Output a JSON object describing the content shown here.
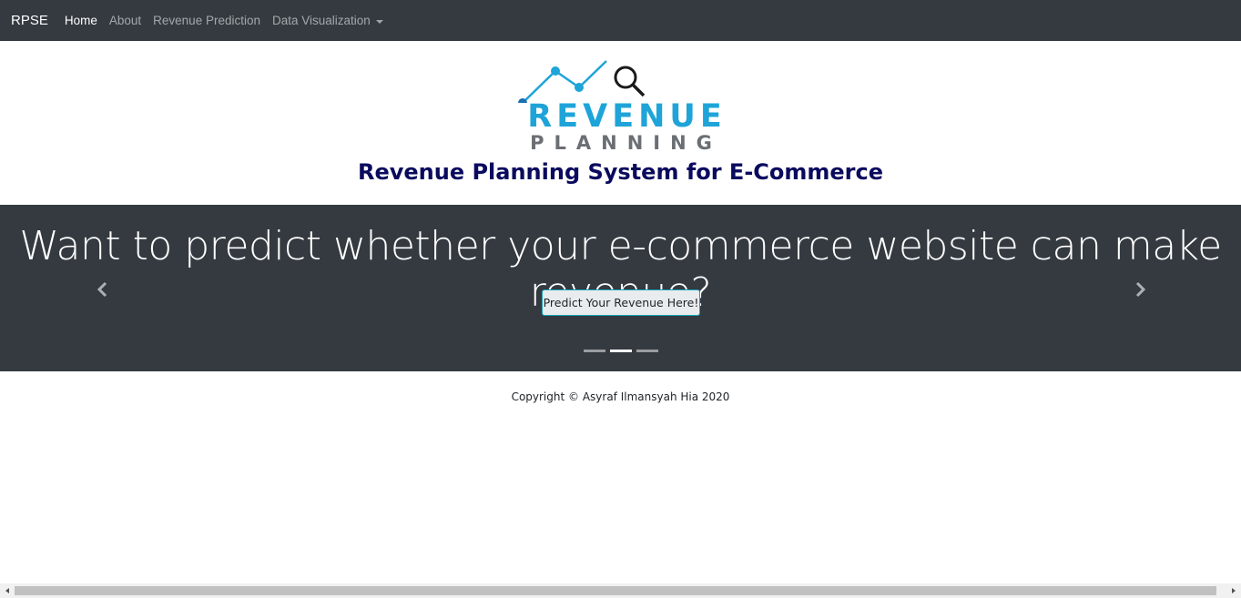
{
  "navbar": {
    "brand": "RPSE",
    "items": [
      {
        "label": "Home",
        "active": true
      },
      {
        "label": "About",
        "active": false
      },
      {
        "label": "Revenue Prediction",
        "active": false
      },
      {
        "label": "Data Visualization",
        "active": false,
        "dropdown": true
      }
    ]
  },
  "logo": {
    "line1": "REVENUE",
    "line2": "PLANNING",
    "icon": "line-chart-magnifier-icon"
  },
  "site_title": "Revenue Planning System for E-Commerce",
  "carousel": {
    "headline": "Want to predict whether your e-commerce website can make revenue?",
    "button_label": "Predict Your Revenue Here!",
    "active_slide": 2,
    "slide_count": 3
  },
  "footer": {
    "copyright": "Copyright © Asyraf Ilmansyah Hia 2020"
  },
  "colors": {
    "navbar_bg": "#343a40",
    "logo_blue": "#1ea4d8",
    "logo_gray": "#6b6f74",
    "title_navy": "#0a0a5e"
  }
}
